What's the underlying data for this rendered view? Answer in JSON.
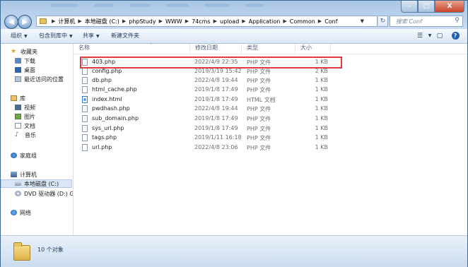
{
  "window": {
    "ghost_title_segments": 6,
    "controls": {
      "minimize": "–",
      "maximize": "□",
      "close": "X"
    }
  },
  "address": {
    "crumbs": [
      "计算机",
      "本地磁盘 (C:)",
      "phpStudy",
      "WWW",
      "74cms",
      "upload",
      "Application",
      "Common",
      "Conf"
    ]
  },
  "search": {
    "placeholder": "搜索 Conf"
  },
  "toolbar": {
    "organize": "组织",
    "include_in_library": "包含到库中",
    "share": "共享",
    "new_folder": "新建文件夹"
  },
  "nav": {
    "favorites": "收藏夹",
    "downloads": "下载",
    "desktop": "桌面",
    "recent": "最近访问的位置",
    "libraries": "库",
    "videos": "视频",
    "pictures": "图片",
    "documents": "文档",
    "music": "音乐",
    "homegroup": "家庭组",
    "computer": "计算机",
    "local_disk": "本地磁盘 (C:)",
    "dvd": "DVD 驱动器 (D:) GSI",
    "network": "网络"
  },
  "columns": {
    "name": "名称",
    "date": "修改日期",
    "type": "类型",
    "size": "大小"
  },
  "files": [
    {
      "name": "403.php",
      "date": "2022/4/9 22:35",
      "type": "PHP 文件",
      "size": "1 KB",
      "icon": "php"
    },
    {
      "name": "config.php",
      "date": "2019/3/19 15:42",
      "type": "PHP 文件",
      "size": "2 KB",
      "icon": "php"
    },
    {
      "name": "db.php",
      "date": "2022/4/8 19:44",
      "type": "PHP 文件",
      "size": "1 KB",
      "icon": "php"
    },
    {
      "name": "html_cache.php",
      "date": "2019/1/8 17:49",
      "type": "PHP 文件",
      "size": "1 KB",
      "icon": "php"
    },
    {
      "name": "index.html",
      "date": "2019/1/8 17:49",
      "type": "HTML 文档",
      "size": "1 KB",
      "icon": "html"
    },
    {
      "name": "pwdhash.php",
      "date": "2022/4/8 19:44",
      "type": "PHP 文件",
      "size": "1 KB",
      "icon": "php"
    },
    {
      "name": "sub_domain.php",
      "date": "2019/1/8 17:49",
      "type": "PHP 文件",
      "size": "1 KB",
      "icon": "php"
    },
    {
      "name": "sys_url.php",
      "date": "2019/1/8 17:49",
      "type": "PHP 文件",
      "size": "1 KB",
      "icon": "php"
    },
    {
      "name": "tags.php",
      "date": "2019/1/11 16:18",
      "type": "PHP 文件",
      "size": "1 KB",
      "icon": "php"
    },
    {
      "name": "url.php",
      "date": "2022/4/8 23:06",
      "type": "PHP 文件",
      "size": "1 KB",
      "icon": "php"
    }
  ],
  "status": {
    "item_count": "10 个对象"
  }
}
